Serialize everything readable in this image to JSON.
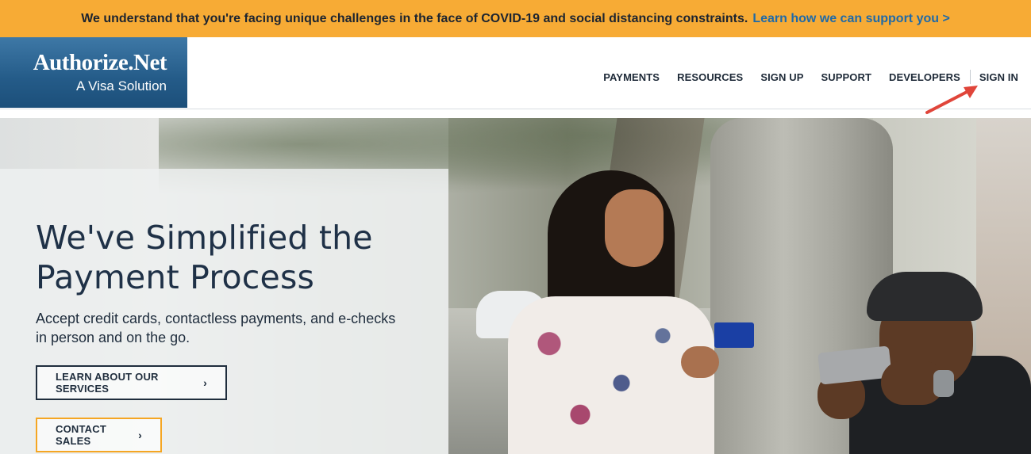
{
  "banner": {
    "message": "We understand that you're facing unique challenges in the face of COVID-19 and social distancing constraints.",
    "link": "Learn how we can support you >"
  },
  "logo": {
    "brand": "Authorize.Net",
    "tagline": "A Visa Solution"
  },
  "nav": {
    "items": [
      "PAYMENTS",
      "RESOURCES",
      "SIGN UP",
      "SUPPORT",
      "DEVELOPERS"
    ],
    "signin": "SIGN IN"
  },
  "hero": {
    "headline_line1": "We've Simplified the",
    "headline_line2": "Payment Process",
    "subtext_line1": "Accept credit cards, contactless payments, and e-checks",
    "subtext_line2": "in person and on the go.",
    "primary_button": "LEARN ABOUT OUR SERVICES",
    "secondary_button": "CONTACT SALES",
    "chevron": "›"
  },
  "colors": {
    "banner_bg": "#f7ab35",
    "link": "#1f6aa8",
    "logo_bg": "#245b88",
    "annotation_arrow": "#e0453a",
    "contact_button_border": "#f5a623"
  },
  "icons": {
    "annotation": "red-arrow-icon",
    "chevron": "chevron-right-icon"
  }
}
